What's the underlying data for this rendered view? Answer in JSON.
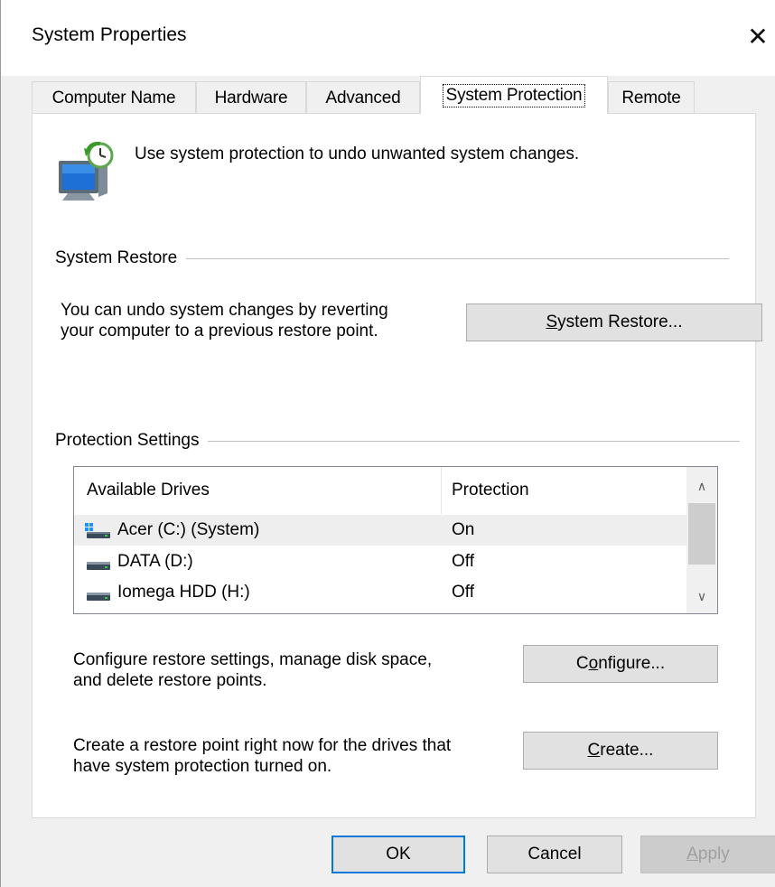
{
  "window": {
    "title": "System Properties",
    "close_glyph": "✕"
  },
  "tabs": [
    {
      "label": "Computer Name",
      "active": false
    },
    {
      "label": "Hardware",
      "active": false
    },
    {
      "label": "Advanced",
      "active": false
    },
    {
      "label": "System Protection",
      "active": true
    },
    {
      "label": "Remote",
      "active": false
    }
  ],
  "header": {
    "icon": "system-protection-icon",
    "text": "Use system protection to undo unwanted system changes."
  },
  "system_restore": {
    "group_label": "System Restore",
    "description_line1": "You can undo system changes by reverting",
    "description_line2": "your computer to a previous restore point.",
    "button_mnemonic": "S",
    "button_rest": "ystem Restore..."
  },
  "protection": {
    "group_label": "Protection Settings",
    "columns": [
      "Available Drives",
      "Protection"
    ],
    "drives": [
      {
        "name": "Acer (C:) (System)",
        "protection": "On",
        "icon": "system-drive-icon",
        "selected": true
      },
      {
        "name": "DATA (D:)",
        "protection": "Off",
        "icon": "hard-drive-icon",
        "selected": false
      },
      {
        "name": "Iomega HDD (H:)",
        "protection": "Off",
        "icon": "hard-drive-icon",
        "selected": false
      }
    ],
    "configure_text_line1": "Configure restore settings, manage disk space,",
    "configure_text_line2": "and delete restore points.",
    "configure_button_pre": "C",
    "configure_button_mnemonic": "o",
    "configure_button_rest": "nfigure...",
    "create_text_line1": "Create a restore point right now for the drives that",
    "create_text_line2": "have system protection turned on.",
    "create_button_mnemonic": "C",
    "create_button_rest": "reate..."
  },
  "footer": {
    "ok": "OK",
    "cancel": "Cancel",
    "apply_mnemonic": "A",
    "apply_rest": "pply"
  },
  "colors": {
    "default_button_border": "#0078d7",
    "selection": "#eeeeee"
  }
}
